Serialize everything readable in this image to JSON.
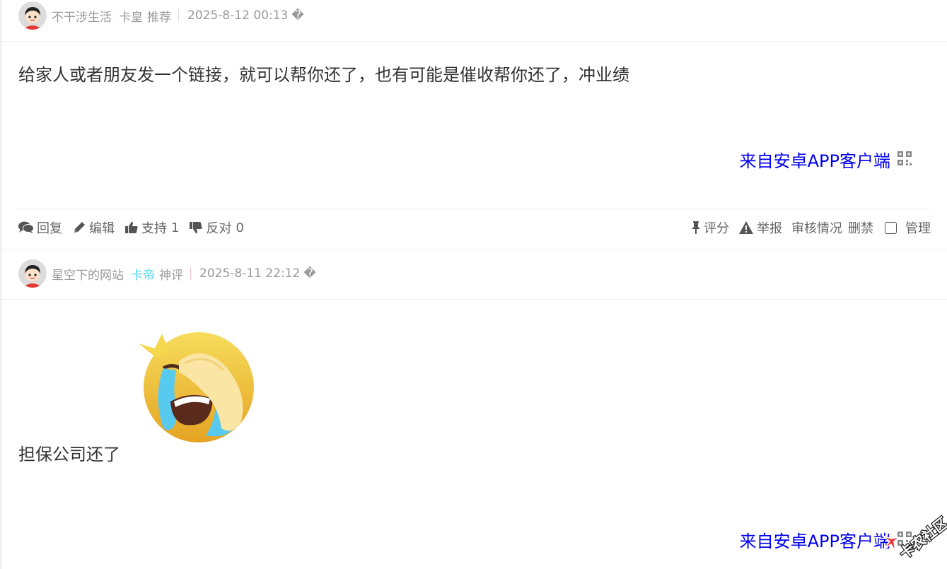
{
  "posts": [
    {
      "author": "不干涉生活",
      "level": "卡皇",
      "tag": "推荐",
      "timestamp": "2025-8-12 00:13",
      "timestamp_suffix": "�",
      "content": "给家人或者朋友发一个链接，就可以帮你还了，也有可能是催收帮你还了，冲业绩",
      "from_app": "来自安卓APP客户端"
    },
    {
      "author": "星空下的网站",
      "level": "卡帝",
      "tag": "神评",
      "timestamp": "2025-8-11 22:12",
      "timestamp_suffix": "�",
      "content": "担保公司还了",
      "emoji": "laugh-crying-emoji",
      "from_app": "来自安卓APP客户端"
    }
  ],
  "actions": {
    "reply": "回复",
    "edit": "编辑",
    "support": "支持",
    "support_count": "1",
    "oppose": "反对",
    "oppose_count": "0",
    "rate": "评分",
    "report": "举报",
    "audit": "审核情况",
    "ban": "删禁",
    "manage": "管理"
  },
  "watermark": "卡农社区",
  "colors": {
    "link": "#0000ee",
    "level_blue": "#4dd6f0",
    "meta_gray": "#999999"
  }
}
